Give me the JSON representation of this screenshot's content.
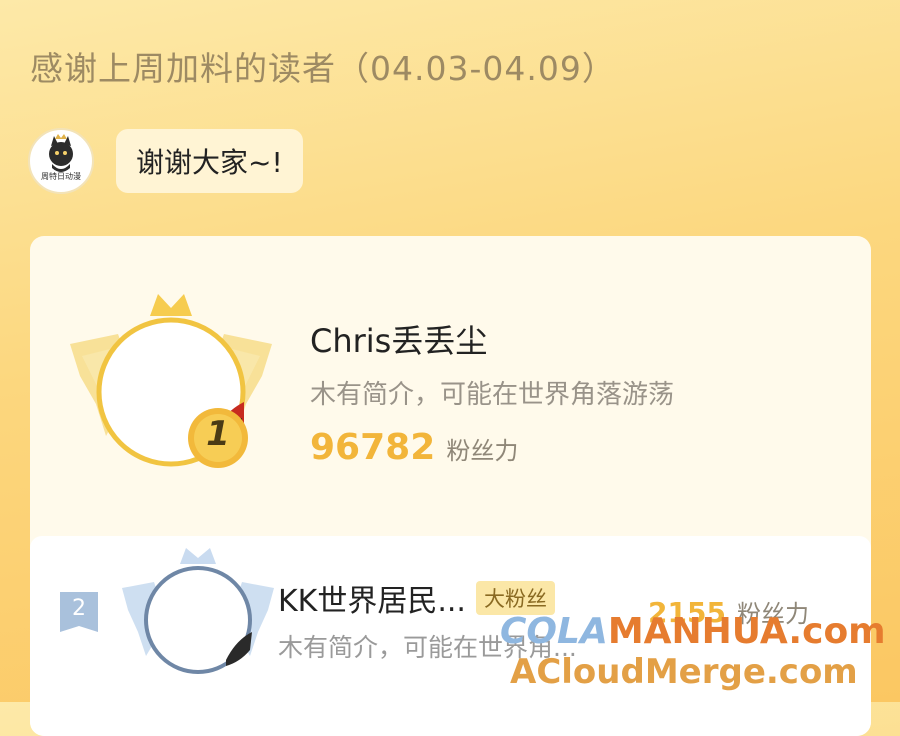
{
  "header": {
    "title": "感谢上周加料的读者（04.03-04.09）"
  },
  "greeting": {
    "avatar_text": "周特日动漫",
    "message": "谢谢大家~!"
  },
  "ranking": [
    {
      "rank": "1",
      "name": "Chris丢丢尘",
      "bio": "木有简介，可能在世界角落游荡",
      "score": "96782",
      "score_unit": "粉丝力"
    },
    {
      "rank": "2",
      "name": "KK世界居民...",
      "tag": "大粉丝",
      "bio": "木有简介，可能在世界角...",
      "score": "2155",
      "score_unit": "粉丝力"
    }
  ],
  "watermark": {
    "line1_part1": "COLA",
    "line1_part2": "MANHUA.com",
    "line2": "ACloudMerge.com"
  },
  "colors": {
    "background_top": "#fde9a8",
    "background_bottom": "#fbc762",
    "gold": "#f2b53a",
    "silver": "#a9c1dc"
  },
  "icons": {
    "first_frame": "gold-crown-wings-frame-icon",
    "second_frame": "silver-crown-wings-frame-icon",
    "rank_1": "gold-medal-icon",
    "rank_2": "silver-ribbon-badge-icon",
    "host_avatar": "cat-logo-icon"
  }
}
